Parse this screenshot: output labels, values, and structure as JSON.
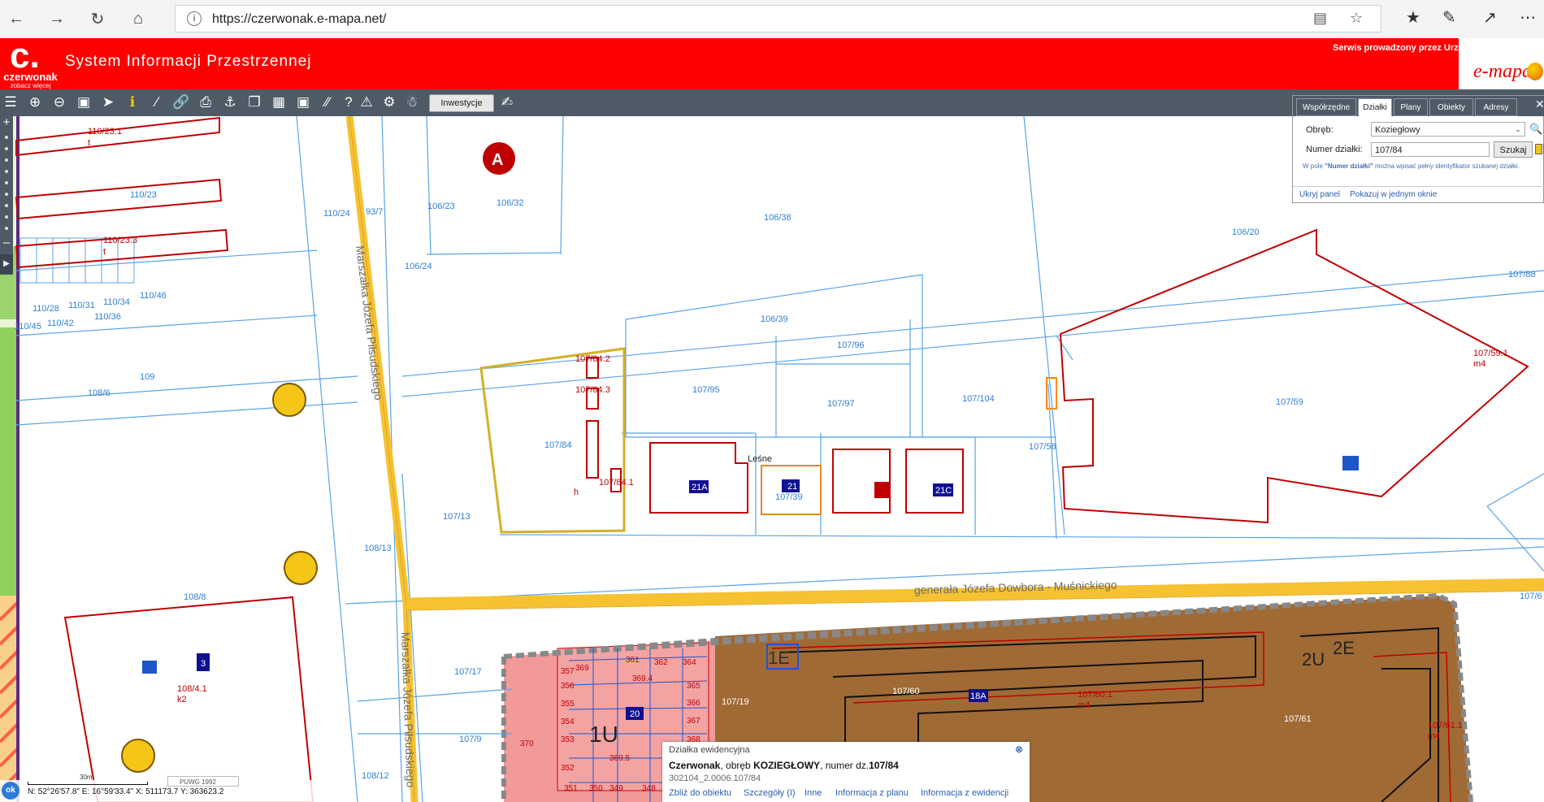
{
  "browser": {
    "url": "https://czerwonak.e-mapa.net/",
    "back_icon": "arrow-left-icon",
    "forward_icon": "arrow-right-icon",
    "refresh_icon": "refresh-icon",
    "home_icon": "home-icon"
  },
  "header": {
    "logo_letter": "c.",
    "logo_name": "czerwonak",
    "logo_tagline": "zobacz więcej",
    "title": "System Informacji Przestrzennej",
    "service_text": "Serwis prowadzony przez Urz",
    "emapa_logo": "e-mapa",
    "background_color": "#ff0000"
  },
  "toolbar": {
    "investycje_label": "Inwestycje"
  },
  "search_panel": {
    "tabs": [
      "Współrzędne",
      "Działki",
      "Plany",
      "Obiekty",
      "Adresy"
    ],
    "active_tab": "Działki",
    "obreb_label": "Obręb:",
    "obreb_value": "Koziegłowy",
    "numer_label": "Numer działki:",
    "numer_value": "107/84",
    "search_button": "Szukaj",
    "hint_prefix": "W pole ",
    "hint_bold": "\"Numer działki\"",
    "hint_suffix": " można wpisać pełny identyfikator szukanej działki.",
    "link_hide": "Ukryj panel",
    "link_single": "Pokazuj w jednym oknie",
    "swatch_colors": [
      "#f0c419",
      "#ff2020",
      "#3fa33f"
    ]
  },
  "popup": {
    "title": "Działka ewidencyjna",
    "gmina": "Czerwonak",
    "obreb_text": ", obręb ",
    "obreb": "KOZIEGŁOWY",
    "numer_text": ", numer dz.",
    "numer": "107/84",
    "identifier": "302104_2.0006.107/84",
    "links": [
      "Zbliż do obiektu",
      "Szczegóły (I)",
      "Inne",
      "Informacja z planu",
      "Informacja z ewidencji"
    ]
  },
  "status": {
    "ok_label": "ok",
    "coords": "N: 52°26'57.8\"  E: 16°59'33.4\"   X: 511173.7   Y: 363623.2",
    "scale_label": "30m",
    "crs": "PUWG 1992"
  },
  "map": {
    "streets": [
      "Marszałka Józefa Piłsudskiego",
      "generała Józefa Dowbora - Muśnickiego",
      "Marszałka Józefa Piłsudskiego"
    ],
    "parcels_blue": [
      "110/23.1",
      "110/23",
      "110/23.3",
      "110/24",
      "93/7",
      "106/23",
      "106/32",
      "106/38",
      "106/20",
      "107/88",
      "106/24",
      "110/46",
      "110/28",
      "110/31",
      "110/34",
      "110/36",
      "110/45",
      "110/42",
      "106/39",
      "107/96",
      "109",
      "108/6",
      "107/95",
      "107/97",
      "107/104",
      "107/59",
      "107/84",
      "107/58",
      "107/13",
      "108/13",
      "107/39",
      "108/8",
      "107/17",
      "107/9",
      "107/19",
      "107/60",
      "107/61",
      "108/12",
      "107/6"
    ],
    "parcels_red": [
      "107/84.2",
      "107/84.3",
      "107/84.1",
      "107/59.1",
      "m4",
      "108/4.1",
      "k2",
      "107/60.1",
      "107/61.1",
      "t",
      "i",
      "h"
    ],
    "building_codes": [
      "21A",
      "21",
      "21C",
      "1U",
      "20",
      "1E",
      "2E",
      "2U",
      "18A",
      "3"
    ],
    "place_label": "Leśne",
    "small_numbers": [
      "369",
      "361",
      "362",
      "364",
      "365",
      "366",
      "367",
      "368",
      "369.4",
      "369.5",
      "351",
      "352",
      "353",
      "354",
      "355",
      "356",
      "357",
      "370",
      "349",
      "350",
      "348"
    ]
  }
}
